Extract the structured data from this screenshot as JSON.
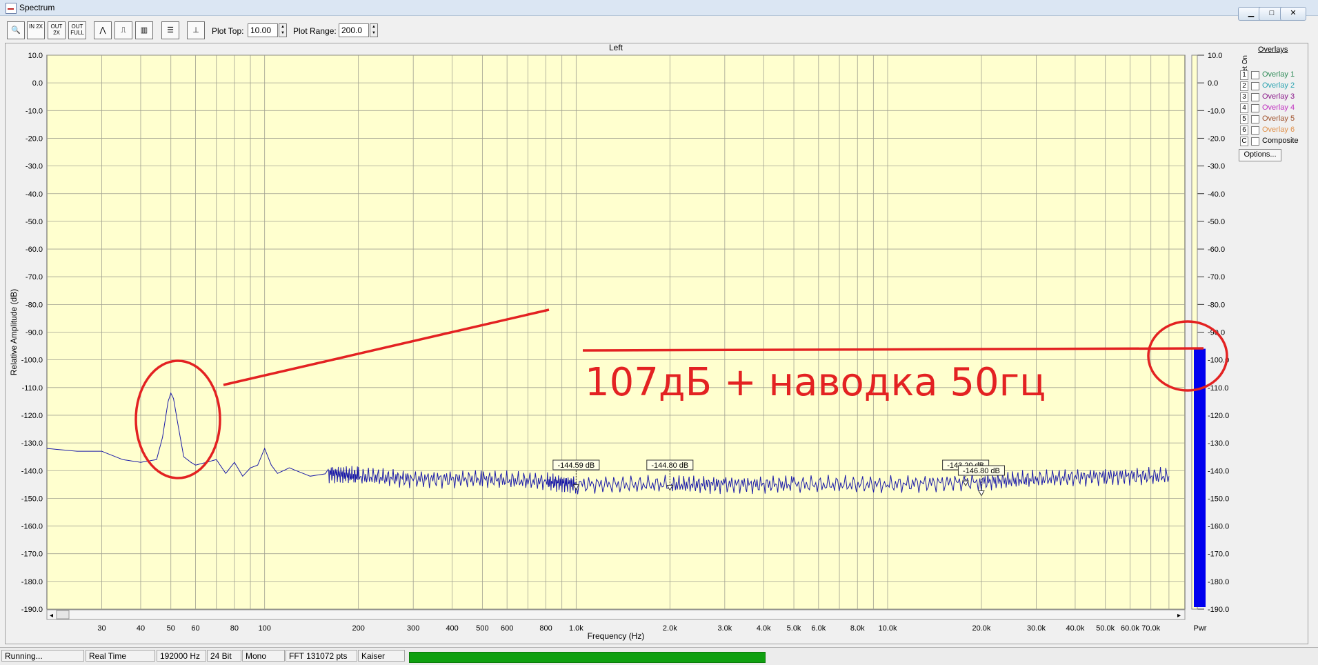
{
  "window": {
    "title": "Spectrum"
  },
  "toolbar": {
    "zoom_label": "",
    "in2x_label": "IN 2X",
    "out2x_label": "OUT 2X",
    "outfull_label": "OUT FULL",
    "plot_top_label": "Plot Top:",
    "plot_top_value": "10.00",
    "plot_range_label": "Plot Range:",
    "plot_range_value": "200.0"
  },
  "chart_data": {
    "type": "line",
    "title": "Left",
    "xlabel": "Frequency (Hz)",
    "ylabel": "Relative Amplitude (dB)",
    "xscale": "log",
    "xlim": [
      20,
      90000
    ],
    "ylim": [
      -190,
      10
    ],
    "yticks": [
      10,
      0,
      -10,
      -20,
      -30,
      -40,
      -50,
      -60,
      -70,
      -80,
      -90,
      -100,
      -110,
      -120,
      -130,
      -140,
      -150,
      -160,
      -170,
      -180,
      -190
    ],
    "ytick_labels": [
      "10.0",
      "0.0",
      "-10.0",
      "-20.0",
      "-30.0",
      "-40.0",
      "-50.0",
      "-60.0",
      "-70.0",
      "-80.0",
      "-90.0",
      "-100.0",
      "-110.0",
      "-120.0",
      "-130.0",
      "-140.0",
      "-150.0",
      "-160.0",
      "-170.0",
      "-180.0",
      "-190.0"
    ],
    "xticks": [
      30,
      40,
      50,
      60,
      80,
      100,
      200,
      300,
      400,
      500,
      600,
      800,
      1000,
      2000,
      3000,
      4000,
      5000,
      6000,
      8000,
      10000,
      20000,
      30000,
      40000,
      50000,
      60000,
      70000
    ],
    "xtick_labels": [
      "30",
      "40",
      "50",
      "60",
      "80",
      "100",
      "200",
      "300",
      "400",
      "500",
      "600",
      "800",
      "1.0k",
      "2.0k",
      "3.0k",
      "4.0k",
      "5.0k",
      "6.0k",
      "8.0k",
      "10.0k",
      "20.0k",
      "30.0k",
      "40.0k",
      "50.0k",
      "60.0k",
      "70.0k"
    ],
    "series": [
      {
        "name": "",
        "color": "#1a1aa8",
        "x": [
          20,
          25,
          30,
          35,
          40,
          45,
          47,
          49,
          50,
          51,
          53,
          55,
          58,
          60,
          65,
          70,
          75,
          80,
          85,
          90,
          95,
          100,
          105,
          110,
          120,
          140,
          160,
          200,
          300,
          500,
          800,
          1000,
          2000,
          3000,
          5000,
          10000,
          20000,
          30000,
          50000,
          80000
        ],
        "y": [
          -132,
          -133,
          -133,
          -136,
          -137,
          -136,
          -128,
          -115,
          -112,
          -114,
          -125,
          -135,
          -137,
          -138,
          -137,
          -136,
          -141,
          -137,
          -142,
          -139,
          -138,
          -132,
          -138,
          -141,
          -139,
          -142,
          -141,
          -142,
          -143,
          -143,
          -144,
          -145,
          -145,
          -145,
          -145,
          -145,
          -144,
          -143,
          -142,
          -142
        ]
      }
    ],
    "markers": [
      {
        "label": "-144.59 dB",
        "x": 1000,
        "y": -144.59
      },
      {
        "label": "-144.80 dB",
        "x": 2000,
        "y": -144.8
      },
      {
        "label": "-143.20 dB",
        "x": 17800,
        "y": -143.2
      },
      {
        "label": "-146.80 dB",
        "x": 20000,
        "y": -146.8
      }
    ],
    "power_bar": {
      "label": "Pwr",
      "value": -96,
      "color": "#0000ee"
    },
    "grid": true
  },
  "overlays": {
    "title": "Overlays",
    "set_on_label": "Set On",
    "items": [
      {
        "num": "1",
        "name": "Overlay 1",
        "color": "#2e8b57"
      },
      {
        "num": "2",
        "name": "Overlay 2",
        "color": "#2aa3b0"
      },
      {
        "num": "3",
        "name": "Overlay 3",
        "color": "#8b1a8b"
      },
      {
        "num": "4",
        "name": "Overlay 4",
        "color": "#c030c0"
      },
      {
        "num": "5",
        "name": "Overlay 5",
        "color": "#a0522d"
      },
      {
        "num": "6",
        "name": "Overlay 6",
        "color": "#e0904a"
      },
      {
        "num": "C",
        "name": "Composite",
        "color": "#000000"
      }
    ],
    "options_label": "Options..."
  },
  "annotation": {
    "text": "107дБ + наводка 50гц",
    "color": "#e32222"
  },
  "statusbar": {
    "state": "Running...",
    "mode": "Real Time",
    "rate": "192000 Hz",
    "bits": "24 Bit",
    "channels": "Mono",
    "fft": "FFT 131072 pts",
    "window": "Kaiser"
  }
}
